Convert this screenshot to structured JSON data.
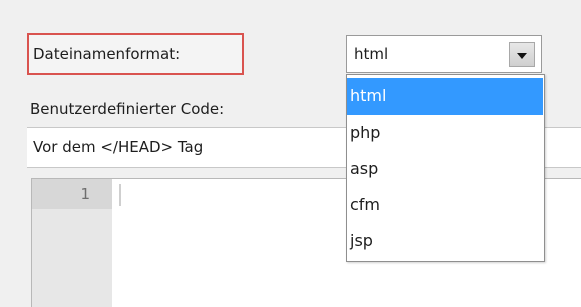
{
  "form": {
    "filename_format_label": "Dateinamenformat:",
    "filename_format_value": "html",
    "custom_code_label": "Benutzerdefinierter Code:",
    "position_value": "Vor dem </HEAD> Tag"
  },
  "editor": {
    "line_number": "1"
  },
  "dropdown": {
    "options": [
      "html",
      "php",
      "asp",
      "cfm",
      "jsp"
    ],
    "selected": "html"
  },
  "colors": {
    "highlight": "#3399ff",
    "label_border": "#d9534f",
    "editor_gutter": "#e7e7e7"
  },
  "icons": {
    "select_arrow": "chevron-down-icon"
  }
}
